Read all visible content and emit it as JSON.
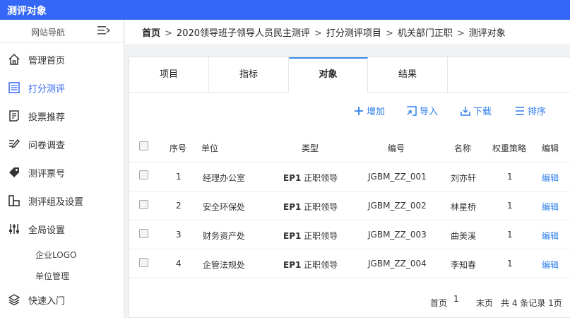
{
  "app": {
    "title": "测评对象"
  },
  "sidebar": {
    "header": "网站导航",
    "items": [
      {
        "label": "管理首页",
        "icon": "home-icon"
      },
      {
        "label": "打分测评",
        "icon": "list-icon"
      },
      {
        "label": "投票推荐",
        "icon": "vote-icon"
      },
      {
        "label": "问卷调查",
        "icon": "edit-icon"
      },
      {
        "label": "测评票号",
        "icon": "tag-icon"
      },
      {
        "label": "测评组及设置",
        "icon": "grid-icon"
      },
      {
        "label": "全局设置",
        "icon": "sliders-icon"
      },
      {
        "label": "快速入门",
        "icon": "layers-icon"
      }
    ],
    "subitems": [
      {
        "label": "企业LOGO"
      },
      {
        "label": "单位管理"
      }
    ]
  },
  "breadcrumb": {
    "home": "首页",
    "sep": ">",
    "items": [
      "2020领导班子领导人员民主测评",
      "打分测评项目",
      "机关部门正职",
      "测评对象"
    ]
  },
  "tabs": [
    {
      "label": "项目"
    },
    {
      "label": "指标"
    },
    {
      "label": "对象"
    },
    {
      "label": "结果"
    }
  ],
  "toolbar": {
    "add": "增加",
    "import": "导入",
    "download": "下载",
    "sort": "排序"
  },
  "table": {
    "headers": {
      "index": "序号",
      "unit": "单位",
      "type": "类型",
      "code": "编号",
      "name": "名称",
      "weight": "权重策略",
      "edit": "编辑"
    },
    "rows": [
      {
        "index": "1",
        "unit": "经理办公室",
        "type_code": "EP1",
        "type": "正职领导",
        "code": "JGBM_ZZ_001",
        "name": "刘亦轩",
        "weight": "1",
        "edit": "编辑"
      },
      {
        "index": "2",
        "unit": "安全环保处",
        "type_code": "EP1",
        "type": "正职领导",
        "code": "JGBM_ZZ_002",
        "name": "林星桥",
        "weight": "1",
        "edit": "编辑"
      },
      {
        "index": "3",
        "unit": "财务资产处",
        "type_code": "EP1",
        "type": "正职领导",
        "code": "JGBM_ZZ_003",
        "name": "曲美溪",
        "weight": "1",
        "edit": "编辑"
      },
      {
        "index": "4",
        "unit": "企管法规处",
        "type_code": "EP1",
        "type": "正职领导",
        "code": "JGBM_ZZ_004",
        "name": "李知春",
        "weight": "1",
        "edit": "编辑"
      }
    ]
  },
  "pager": {
    "first": "首页",
    "current": "1",
    "last": "末页",
    "summary": "共 4 条记录 1页"
  },
  "colors": {
    "topbar": "#3467f5",
    "accent": "#2d7ee8",
    "page_current": "#409eff"
  }
}
